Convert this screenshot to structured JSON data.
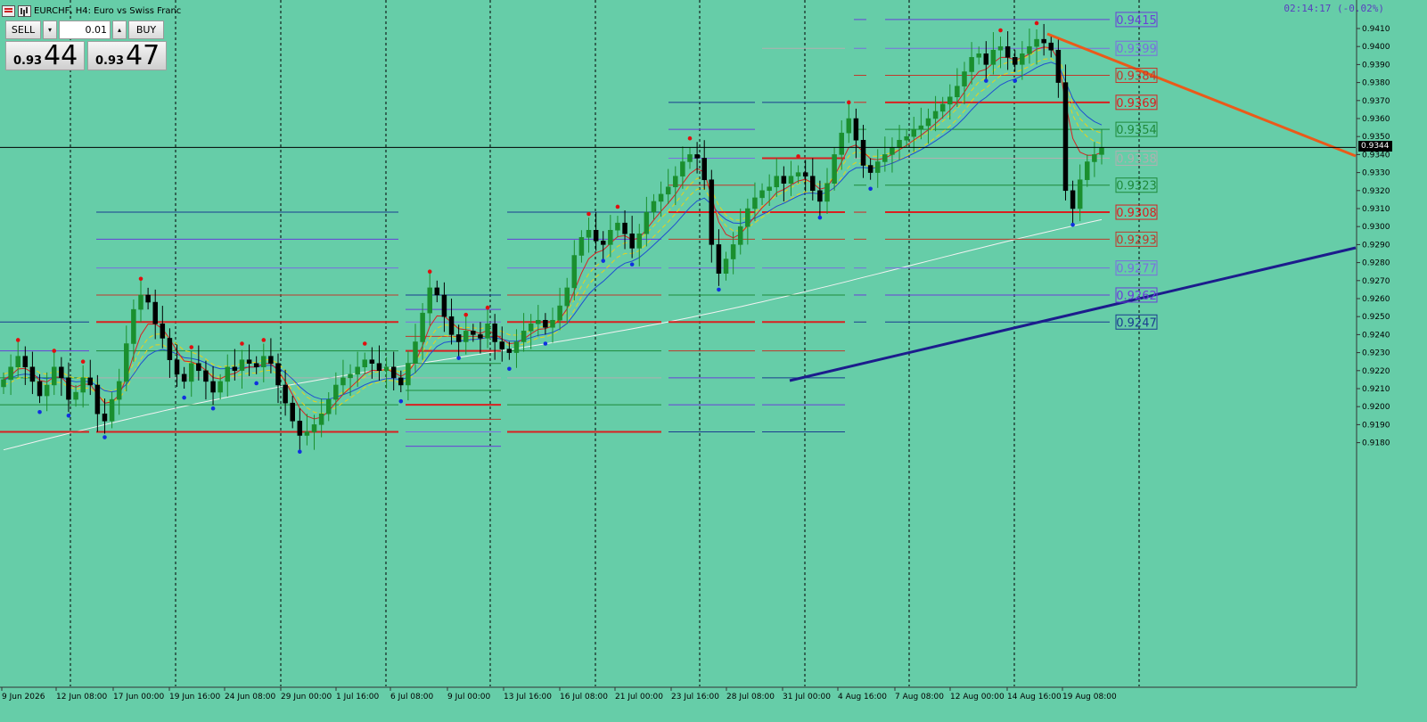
{
  "title": {
    "symbol_text": "EURCHF, H4:  Euro vs Swiss Franc",
    "icons": [
      "menu-icon",
      "chart-bars-icon"
    ]
  },
  "timer": "02:14:17 (-0.02%)",
  "trade_panel": {
    "sell_label": "SELL",
    "buy_label": "BUY",
    "lot_value": "0.01",
    "sell_price_small": "0.93",
    "sell_price_big": "44",
    "buy_price_small": "0.93",
    "buy_price_big": "47"
  },
  "price_axis": {
    "ticks": [
      "0.9410",
      "0.9400",
      "0.9390",
      "0.9380",
      "0.9370",
      "0.9360",
      "0.9350",
      "0.9340",
      "0.9330",
      "0.9320",
      "0.9310",
      "0.9300",
      "0.9290",
      "0.9280",
      "0.9270",
      "0.9260",
      "0.9250",
      "0.9240",
      "0.9230",
      "0.9220",
      "0.9210",
      "0.9200",
      "0.9190",
      "0.9180"
    ],
    "current_price": "0.9344"
  },
  "time_axis": {
    "labels": [
      "9 Jun 2026",
      "12 Jun 08:00",
      "17 Jun 00:00",
      "19 Jun 16:00",
      "24 Jun 08:00",
      "29 Jun 00:00",
      "1 Jul 16:00",
      "6 Jul 08:00",
      "9 Jul 00:00",
      "13 Jul 16:00",
      "16 Jul 08:00",
      "21 Jul 00:00",
      "23 Jul 16:00",
      "28 Jul 08:00",
      "31 Jul 00:00",
      "4 Aug 16:00",
      "7 Aug 08:00",
      "12 Aug 00:00",
      "14 Aug 16:00",
      "19 Aug 08:00"
    ]
  },
  "levels": [
    {
      "label": "0.9415",
      "price": 0.9415,
      "color": "#6a3fd9"
    },
    {
      "label": "0.9399",
      "price": 0.9399,
      "color": "#7a6ee0"
    },
    {
      "label": "0.9384",
      "price": 0.9384,
      "color": "#c0392b"
    },
    {
      "label": "0.9369",
      "price": 0.9369,
      "color": "#d92020"
    },
    {
      "label": "0.9354",
      "price": 0.9354,
      "color": "#1e8a3a"
    },
    {
      "label": "0.9338",
      "price": 0.9338,
      "color": "#b0b0b0"
    },
    {
      "label": "0.9323",
      "price": 0.9323,
      "color": "#1e8a3a"
    },
    {
      "label": "0.9308",
      "price": 0.9308,
      "color": "#d92020"
    },
    {
      "label": "0.9293",
      "price": 0.9293,
      "color": "#c0392b"
    },
    {
      "label": "0.9277",
      "price": 0.9277,
      "color": "#7a6ee0"
    },
    {
      "label": "0.9262",
      "price": 0.9262,
      "color": "#6a3fd9"
    },
    {
      "label": "0.9247",
      "price": 0.9247,
      "color": "#1a3d8f"
    }
  ],
  "colors": {
    "background": "#66cda8",
    "bull_candle": "#1a8f2e",
    "bear_candle": "#000000",
    "ma_red": "#d92020",
    "ma_blue": "#1f4fd0",
    "ma_white": "#f2f2f2",
    "ma_yellow": "#e8d11a",
    "trend_up": "#1c1c8c",
    "trend_down": "#ea5a1a"
  },
  "chart_data": {
    "type": "candlestick",
    "ylim": [
      0.9175,
      0.9418
    ],
    "closes": [
      0.9215,
      0.9222,
      0.9228,
      0.9222,
      0.9214,
      0.9206,
      0.9212,
      0.9222,
      0.9216,
      0.9204,
      0.9208,
      0.9216,
      0.9212,
      0.9196,
      0.9192,
      0.9204,
      0.9214,
      0.9235,
      0.9254,
      0.9262,
      0.9258,
      0.9246,
      0.9238,
      0.9226,
      0.9218,
      0.9214,
      0.9224,
      0.922,
      0.9214,
      0.9208,
      0.9214,
      0.9222,
      0.922,
      0.9226,
      0.9224,
      0.9222,
      0.9228,
      0.9224,
      0.9212,
      0.9202,
      0.9192,
      0.9184,
      0.9186,
      0.919,
      0.9196,
      0.9204,
      0.9212,
      0.9216,
      0.9218,
      0.9222,
      0.9226,
      0.9224,
      0.922,
      0.9222,
      0.9216,
      0.9212,
      0.9224,
      0.9236,
      0.9252,
      0.9266,
      0.9262,
      0.925,
      0.924,
      0.9236,
      0.9242,
      0.924,
      0.9238,
      0.9246,
      0.9236,
      0.9232,
      0.923,
      0.9236,
      0.9242,
      0.9246,
      0.9248,
      0.9244,
      0.9248,
      0.9256,
      0.9266,
      0.9284,
      0.9294,
      0.9298,
      0.9292,
      0.929,
      0.9298,
      0.9302,
      0.9296,
      0.9288,
      0.9296,
      0.9308,
      0.9314,
      0.9318,
      0.9322,
      0.9328,
      0.9336,
      0.934,
      0.9338,
      0.9326,
      0.929,
      0.9274,
      0.9282,
      0.929,
      0.93,
      0.931,
      0.9316,
      0.932,
      0.9322,
      0.9328,
      0.9324,
      0.9328,
      0.933,
      0.9328,
      0.932,
      0.9314,
      0.9324,
      0.934,
      0.9352,
      0.936,
      0.9348,
      0.9334,
      0.933,
      0.9336,
      0.934,
      0.9344,
      0.9348,
      0.935,
      0.9354,
      0.9356,
      0.936,
      0.9364,
      0.9368,
      0.9372,
      0.9378,
      0.9386,
      0.9394,
      0.9396,
      0.939,
      0.9398,
      0.94,
      0.9394,
      0.939,
      0.9396,
      0.94,
      0.9404,
      0.9402,
      0.9398,
      0.938,
      0.932,
      0.931,
      0.9326,
      0.9336,
      0.934,
      0.9344
    ],
    "trendlines": [
      {
        "name": "support",
        "from": [
          886,
          427
        ],
        "to": [
          1521,
          278
        ]
      },
      {
        "name": "resistance",
        "from": [
          1175,
          38
        ],
        "to": [
          1521,
          175
        ]
      }
    ]
  }
}
